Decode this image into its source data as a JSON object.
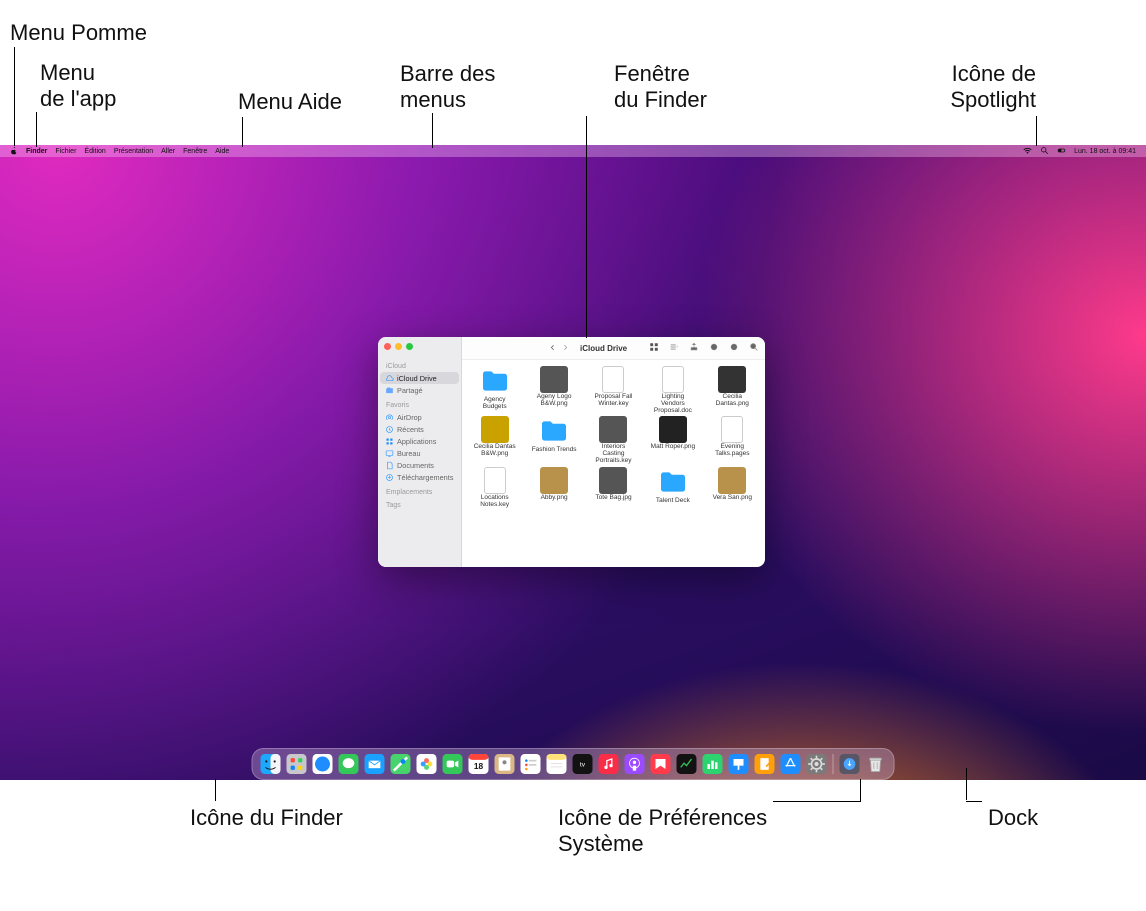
{
  "callouts": {
    "menu_pomme": "Menu Pomme",
    "menu_app": "Menu\nde l'app",
    "menu_aide": "Menu Aide",
    "barre_menus": "Barre des\nmenus",
    "fenetre_finder": "Fenêtre\ndu Finder",
    "icone_spotlight": "Icône de\nSpotlight",
    "icone_finder": "Icône du Finder",
    "icone_preferences": "Icône de Préférences\nSystème",
    "dock": "Dock"
  },
  "menubar": {
    "apple": "",
    "items": [
      "Finder",
      "Fichier",
      "Édition",
      "Présentation",
      "Aller",
      "Fenêtre",
      "Aide"
    ],
    "status_datetime": "Lun. 18 oct. à  09:41"
  },
  "finder": {
    "title": "iCloud Drive",
    "sidebar": {
      "sections": [
        {
          "label": "iCloud",
          "items": [
            {
              "icon": "cloud",
              "label": "iCloud Drive",
              "selected": true
            },
            {
              "icon": "shared",
              "label": "Partagé"
            }
          ]
        },
        {
          "label": "Favoris",
          "items": [
            {
              "icon": "airdrop",
              "label": "AirDrop"
            },
            {
              "icon": "clock",
              "label": "Récents"
            },
            {
              "icon": "apps",
              "label": "Applications"
            },
            {
              "icon": "desktop",
              "label": "Bureau"
            },
            {
              "icon": "doc",
              "label": "Documents"
            },
            {
              "icon": "download",
              "label": "Téléchargements"
            }
          ]
        },
        {
          "label": "Emplacements",
          "items": []
        },
        {
          "label": "Tags",
          "items": []
        }
      ]
    },
    "files": [
      {
        "name": "Agency Budgets",
        "type": "folder"
      },
      {
        "name": "Ageny Logo B&W.png",
        "type": "img"
      },
      {
        "name": "Proposal Fall Winter.key",
        "type": "doc"
      },
      {
        "name": "Lighting Vendors Proposal.doc",
        "type": "doc"
      },
      {
        "name": "Cecilia Dantas.png",
        "type": "img"
      },
      {
        "name": "Cecilia Dantas B&W.png",
        "type": "img"
      },
      {
        "name": "Fashion Trends",
        "type": "folder"
      },
      {
        "name": "Interiors Casting Portraits.key",
        "type": "img"
      },
      {
        "name": "Matt Roper.png",
        "type": "img"
      },
      {
        "name": "Evening Talks.pages",
        "type": "doc"
      },
      {
        "name": "Locations Notes.key",
        "type": "doc"
      },
      {
        "name": "Abby.png",
        "type": "img"
      },
      {
        "name": "Tote Bag.jpg",
        "type": "img"
      },
      {
        "name": "Talent Deck",
        "type": "folder"
      },
      {
        "name": "Vera San.png",
        "type": "img"
      }
    ]
  },
  "dock": {
    "apps": [
      {
        "name": "finder",
        "color": "#1da8ff"
      },
      {
        "name": "launchpad",
        "color": "#b7b7b7"
      },
      {
        "name": "safari",
        "color": "#1e8dff"
      },
      {
        "name": "messages",
        "color": "#34c759"
      },
      {
        "name": "mail",
        "color": "#1aa0ff"
      },
      {
        "name": "maps",
        "color": "#47d46c"
      },
      {
        "name": "photos",
        "color": "#fff"
      },
      {
        "name": "facetime",
        "color": "#34c759"
      },
      {
        "name": "calendar",
        "color": "#fff"
      },
      {
        "name": "contacts",
        "color": "#d9b786"
      },
      {
        "name": "reminders",
        "color": "#fff"
      },
      {
        "name": "notes",
        "color": "#ffe27a"
      },
      {
        "name": "tv",
        "color": "#121212"
      },
      {
        "name": "music",
        "color": "#fa2d48"
      },
      {
        "name": "podcasts",
        "color": "#9b4bff"
      },
      {
        "name": "news",
        "color": "#ff3b4c"
      },
      {
        "name": "stocks",
        "color": "#121212"
      },
      {
        "name": "numbers",
        "color": "#2dd36f"
      },
      {
        "name": "keynote",
        "color": "#1e8dff"
      },
      {
        "name": "pages",
        "color": "#ff9f0a"
      },
      {
        "name": "appstore",
        "color": "#1e8dff"
      },
      {
        "name": "system-preferences",
        "color": "#7a7a7a"
      }
    ],
    "right": [
      {
        "name": "downloads",
        "color": "#4aa3ff"
      },
      {
        "name": "trash",
        "color": "#e6e6e6"
      }
    ]
  },
  "calendar_day": "18"
}
